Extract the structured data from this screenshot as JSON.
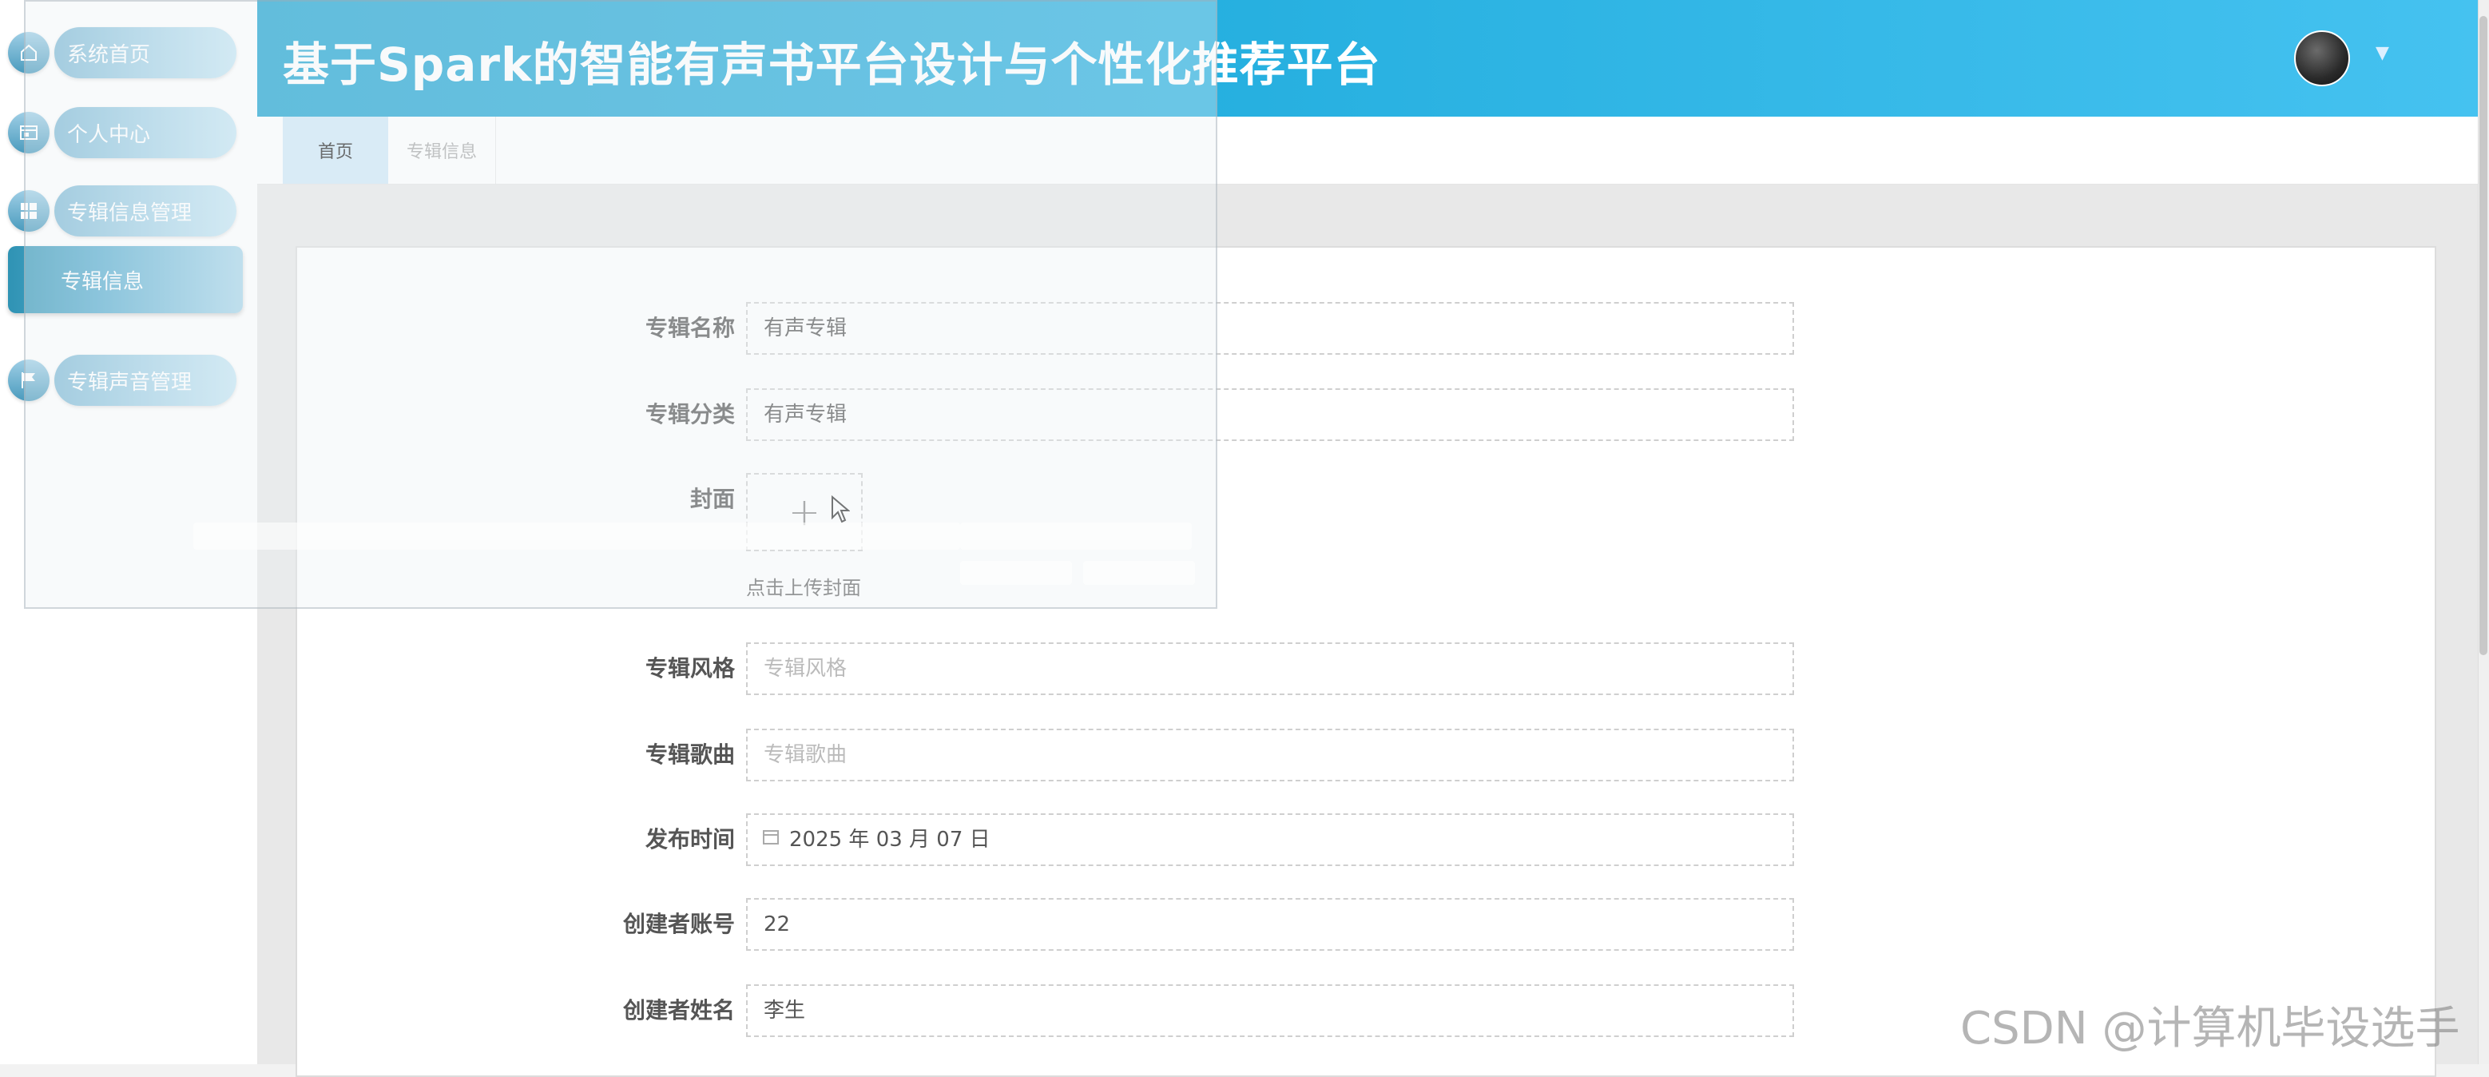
{
  "header": {
    "title": "基于Spark的智能有声书平台设计与个性化推荐平台"
  },
  "sidebar": {
    "items": [
      {
        "label": "系统首页",
        "icon": "home-icon"
      },
      {
        "label": "个人中心",
        "icon": "profile-card-icon"
      },
      {
        "label": "专辑信息管理",
        "icon": "grid-icon"
      },
      {
        "label": "专辑声音管理",
        "icon": "flag-icon"
      }
    ],
    "sub_item": {
      "label": "专辑信息"
    }
  },
  "tabs": [
    {
      "label": "首页",
      "active": true
    },
    {
      "label": "专辑信息",
      "active": false
    }
  ],
  "form": {
    "album_name": {
      "label": "专辑名称",
      "value": "有声专辑"
    },
    "album_category": {
      "label": "专辑分类",
      "value": "有声专辑"
    },
    "cover": {
      "label": "封面",
      "hint": "点击上传封面"
    },
    "album_style": {
      "label": "专辑风格",
      "placeholder": "专辑风格"
    },
    "album_song": {
      "label": "专辑歌曲",
      "placeholder": "专辑歌曲"
    },
    "publish_time": {
      "label": "发布时间",
      "value": "2025 年 03 月 07 日"
    },
    "creator_account": {
      "label": "创建者账号",
      "value": "22"
    },
    "creator_name": {
      "label": "创建者姓名",
      "value": "李生"
    }
  },
  "watermark": "CSDN @计算机毕设选手",
  "colors": {
    "header_start": "#1aa2d0",
    "header_end": "#45c2f0",
    "accent": "#2f93b4"
  }
}
